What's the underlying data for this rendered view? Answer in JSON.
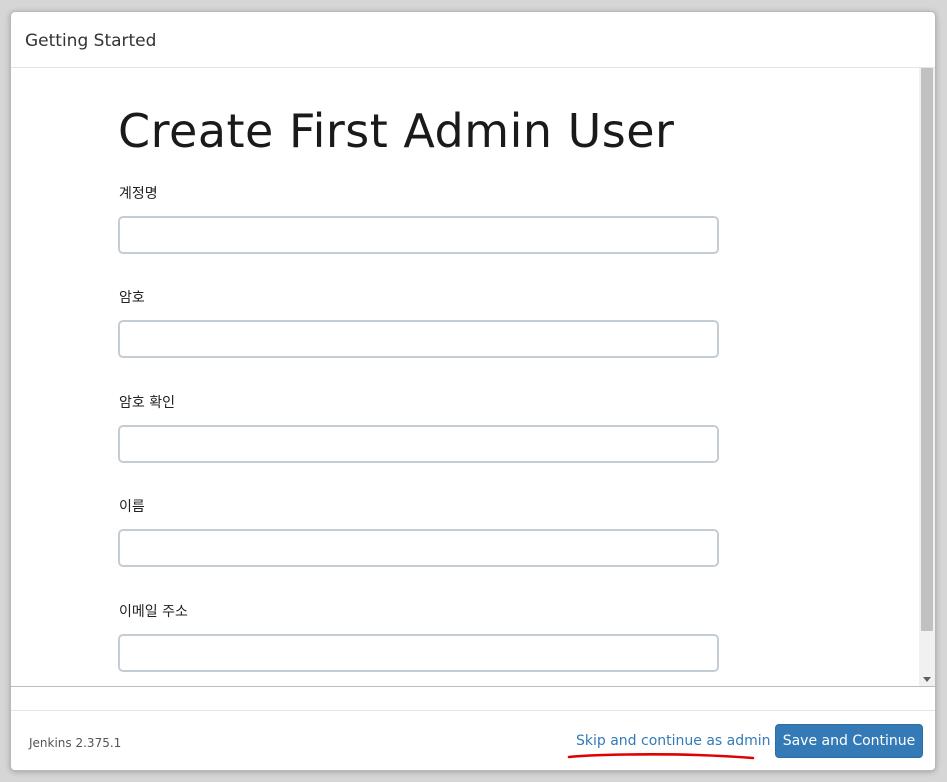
{
  "header": {
    "title": "Getting Started"
  },
  "main": {
    "title": "Create First Admin User",
    "fields": [
      {
        "label": "계정명",
        "value": ""
      },
      {
        "label": "암호",
        "value": ""
      },
      {
        "label": "암호 확인",
        "value": ""
      },
      {
        "label": "이름",
        "value": ""
      },
      {
        "label": "이메일 주소",
        "value": ""
      }
    ]
  },
  "footer": {
    "version": "Jenkins 2.375.1",
    "skip_label": "Skip and continue as admin",
    "save_label": "Save and Continue"
  },
  "colors": {
    "accent": "#337ab7",
    "annotation": "#e00000"
  }
}
